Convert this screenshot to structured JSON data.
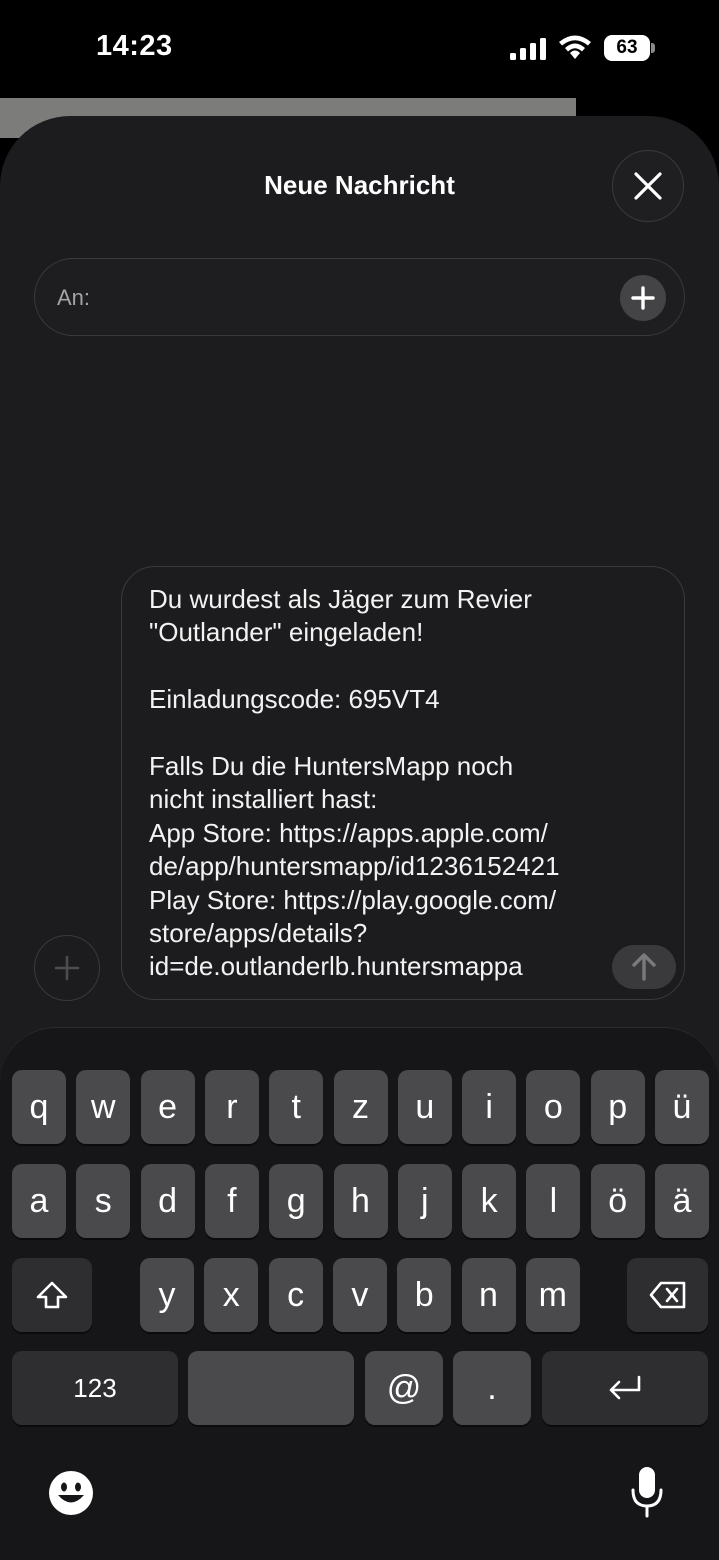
{
  "status_bar": {
    "time": "14:23",
    "battery": "63"
  },
  "compose": {
    "title": "Neue Nachricht",
    "to_label": "An:",
    "message": "Du wurdest als Jäger zum Revier\n\"Outlander\" eingeladen!\n\nEinladungscode: 695VT4\n\nFalls Du die HuntersMapp noch\nnicht installiert hast:\nApp Store: https://apps.apple.com/\nde/app/huntersmapp/id1236152421\nPlay Store: https://play.google.com/\nstore/apps/details?\nid=de.outlanderlb.huntersmappa"
  },
  "keyboard": {
    "row1": [
      "q",
      "w",
      "e",
      "r",
      "t",
      "z",
      "u",
      "i",
      "o",
      "p",
      "ü"
    ],
    "row2": [
      "a",
      "s",
      "d",
      "f",
      "g",
      "h",
      "j",
      "k",
      "l",
      "ö",
      "ä"
    ],
    "row3": [
      "y",
      "x",
      "c",
      "v",
      "b",
      "n",
      "m"
    ],
    "numbers_key": "123",
    "at_key": "@",
    "dot_key": "."
  },
  "icons": [
    "signal-icon",
    "wifi-icon",
    "battery-icon",
    "close-icon",
    "add-recipient-icon",
    "attach-icon",
    "send-icon",
    "shift-icon",
    "delete-icon",
    "return-icon",
    "emoji-icon",
    "microphone-icon"
  ]
}
